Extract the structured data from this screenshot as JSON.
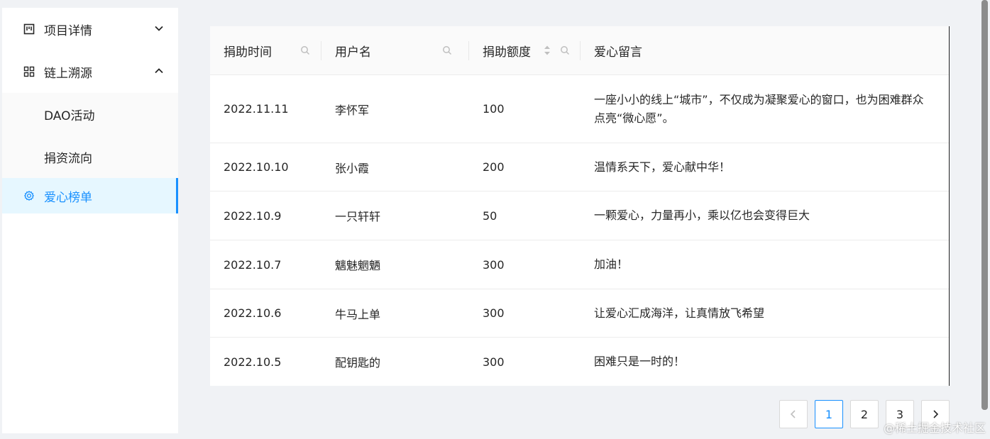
{
  "sidebar": {
    "items": [
      {
        "label": "项目详情",
        "icon": "project-icon",
        "arrow": "chevron-down-icon"
      },
      {
        "label": "链上溯源",
        "icon": "appstore-icon",
        "arrow": "chevron-up-icon",
        "children": [
          {
            "label": "DAO活动"
          },
          {
            "label": "捐资流向"
          }
        ]
      },
      {
        "label": "爱心榜单",
        "icon": "setting-icon",
        "active": true
      }
    ]
  },
  "table": {
    "columns": [
      "捐助时间",
      "用户名",
      "捐助额度",
      "爱心留言"
    ],
    "rows": [
      {
        "date": "2022.11.11",
        "user": "李怀军",
        "amount": "100",
        "message": "一座小小的线上“城市”，不仅成为凝聚爱心的窗口，也为困难群众点亮“微心愿”。"
      },
      {
        "date": "2022.10.10",
        "user": "张小霞",
        "amount": "200",
        "message": "温情系天下，爱心献中华！"
      },
      {
        "date": "2022.10.9",
        "user": "一只轩轩",
        "amount": "50",
        "message": "一颗爱心，力量再小，乘以亿也会变得巨大"
      },
      {
        "date": "2022.10.7",
        "user": "魑魅魍魉",
        "amount": "300",
        "message": "加油！"
      },
      {
        "date": "2022.10.6",
        "user": "牛马上单",
        "amount": "300",
        "message": "让爱心汇成海洋，让真情放飞希望"
      },
      {
        "date": "2022.10.5",
        "user": "配钥匙的",
        "amount": "300",
        "message": "困难只是一时的！"
      }
    ]
  },
  "pagination": {
    "prev": "<",
    "pages": [
      "1",
      "2",
      "3"
    ],
    "next": ">",
    "current": "1"
  },
  "watermark": "@稀土掘金技术社区",
  "colors": {
    "accent": "#1890ff",
    "active_bg": "#e6f7ff",
    "page_bg": "#f0f2f5"
  }
}
